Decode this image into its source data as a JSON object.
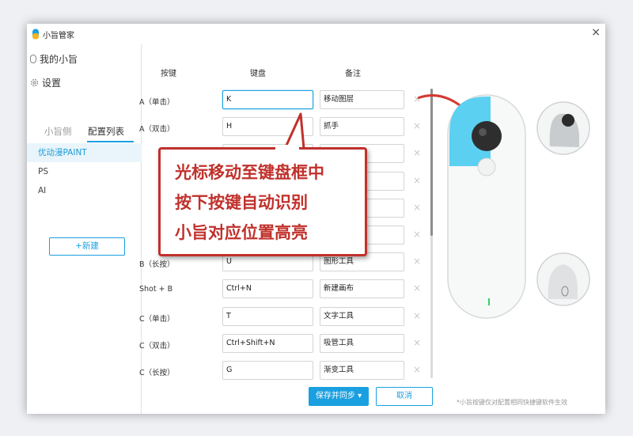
{
  "app": {
    "title": "小旨管家",
    "close": "×"
  },
  "sidebar": {
    "my_device": "我的小旨",
    "settings": "设置",
    "tabs": [
      {
        "label": "小旨侧"
      },
      {
        "label": "配置列表",
        "active": true
      }
    ],
    "presets": [
      {
        "label": "优动漫PAINT",
        "active": true
      },
      {
        "label": "PS"
      },
      {
        "label": "AI"
      }
    ],
    "new_button": "+新建"
  },
  "table": {
    "headers": {
      "button": "按键",
      "keyboard": "键盘",
      "note": "备注"
    },
    "rows": [
      {
        "button": "A（单击）",
        "key": "K",
        "note": "移动图层"
      },
      {
        "button": "A（双击）",
        "key": "H",
        "note": "抓手"
      },
      {
        "button": "",
        "key": "",
        "note": ""
      },
      {
        "button": "",
        "key": "",
        "note": ""
      },
      {
        "button": "",
        "key": "",
        "note": ""
      },
      {
        "button": "",
        "key": "",
        "note": ""
      },
      {
        "button": "B（长按）",
        "key": "U",
        "note": "图形工具"
      },
      {
        "button": "Shot + B",
        "key": "Ctrl+N",
        "note": "新建画布"
      },
      {
        "button": "C（单击）",
        "key": "T",
        "note": "文字工具"
      },
      {
        "button": "C（双击）",
        "key": "Ctrl+Shift+N",
        "note": "吸管工具"
      },
      {
        "button": "C（长按）",
        "key": "G",
        "note": "渐变工具"
      }
    ],
    "delete_glyph": "×"
  },
  "callout": {
    "lines": [
      "光标移动至键盘框中",
      "按下按键自动识别",
      "小旨对应位置高亮"
    ]
  },
  "actions": {
    "save": "保存并同步 ▾",
    "cancel": "取消"
  },
  "footnote": "*小旨按键仅对配置相同快捷键软件生效",
  "colors": {
    "accent": "#1aa0e0",
    "highlight": "#5cd0f0",
    "callout_red": "#c0312c"
  },
  "icons": {
    "app": "device-icon",
    "my_device": "device-outline-icon",
    "settings": "gear-icon",
    "close": "close-icon"
  }
}
